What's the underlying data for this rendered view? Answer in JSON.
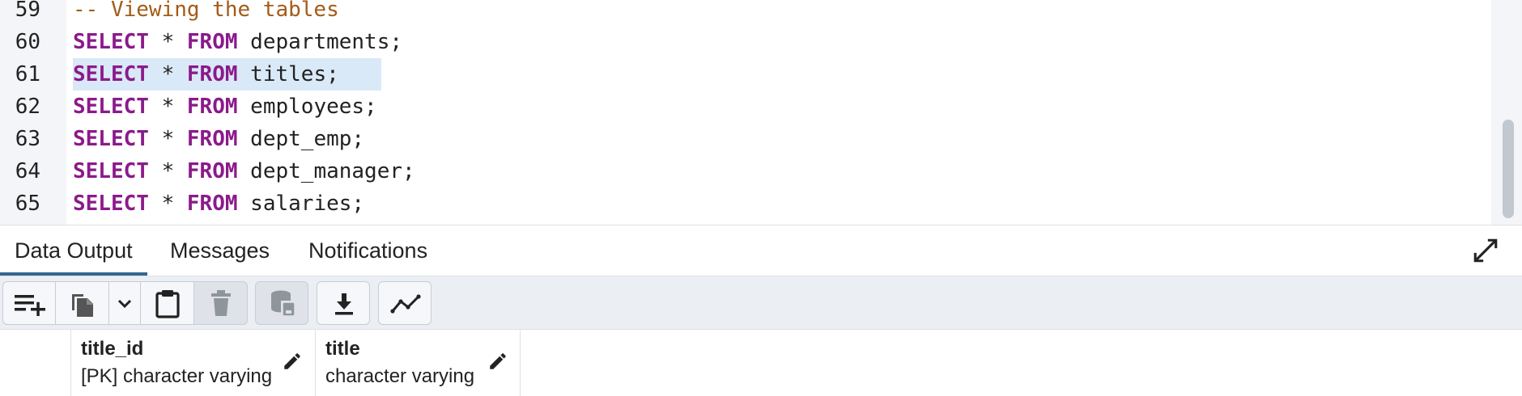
{
  "editor": {
    "lines": [
      {
        "num": "59",
        "comment": "-- Viewing the tables"
      },
      {
        "num": "60",
        "kw1": "SELECT",
        "op": "*",
        "kw2": "FROM",
        "ident": "departments;"
      },
      {
        "num": "61",
        "kw1": "SELECT",
        "op": "*",
        "kw2": "FROM",
        "ident": "titles;",
        "highlighted": true
      },
      {
        "num": "62",
        "kw1": "SELECT",
        "op": "*",
        "kw2": "FROM",
        "ident": "employees;"
      },
      {
        "num": "63",
        "kw1": "SELECT",
        "op": "*",
        "kw2": "FROM",
        "ident": "dept_emp;"
      },
      {
        "num": "64",
        "kw1": "SELECT",
        "op": "*",
        "kw2": "FROM",
        "ident": "dept_manager;"
      },
      {
        "num": "65",
        "kw1": "SELECT",
        "op": "*",
        "kw2": "FROM",
        "ident": "salaries;"
      }
    ]
  },
  "tabs": [
    {
      "label": "Data Output",
      "active": true
    },
    {
      "label": "Messages",
      "active": false
    },
    {
      "label": "Notifications",
      "active": false
    }
  ],
  "toolbar": {
    "icons": [
      "add-row-icon",
      "copy-icon",
      "chevron-down-icon",
      "paste-icon",
      "delete-icon",
      "save-data-icon",
      "download-icon",
      "graph-icon"
    ]
  },
  "grid": {
    "columns": [
      {
        "name": "title_id",
        "type": "[PK] character varying"
      },
      {
        "name": "title",
        "type": "character varying"
      }
    ]
  },
  "colors": {
    "keyword": "#8b1a8b",
    "comment": "#a35b17",
    "selection": "#d9e9f8",
    "active_tab": "#326690",
    "toolbar_bg": "#ebeef3"
  }
}
